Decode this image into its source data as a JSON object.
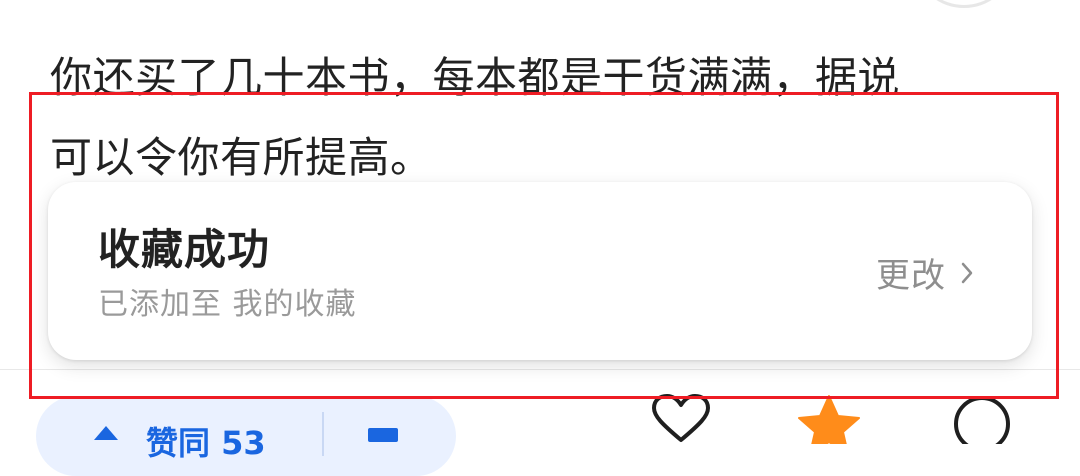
{
  "article": {
    "line1": "你还买了几十本书，每本都是干货满满，据说",
    "line2": "可以令你有所提高。"
  },
  "toast": {
    "title": "收藏成功",
    "subtitle": "已添加至 我的收藏",
    "change_label": "更改"
  },
  "bottom_bar": {
    "vote_label": "赞同 53"
  },
  "colors": {
    "highlight_border": "#ee1c24",
    "accent_blue": "#1a66e0",
    "star_active": "#ff8c1a"
  },
  "icons": {
    "change": "chevron-right-icon",
    "like": "heart-icon",
    "favorite": "star-icon",
    "comment": "comment-icon"
  }
}
